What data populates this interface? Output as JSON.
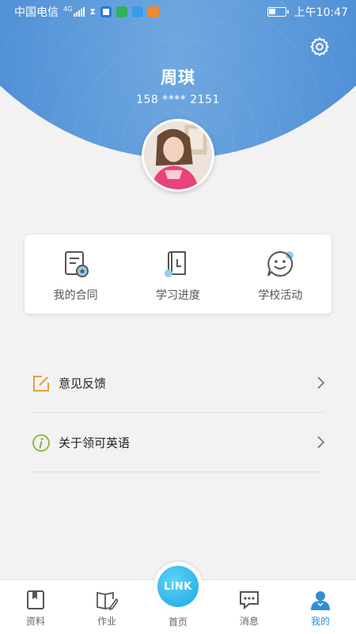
{
  "status_bar": {
    "carrier": "中国电信",
    "network": "4G",
    "time": "上午10:47"
  },
  "profile": {
    "name": "周琪",
    "phone": "158 **** 2151"
  },
  "quick_actions": [
    {
      "label": "我的合同",
      "icon": "contract-icon"
    },
    {
      "label": "学习进度",
      "icon": "progress-book-icon"
    },
    {
      "label": "学校活动",
      "icon": "smiley-chat-icon"
    }
  ],
  "menu": [
    {
      "label": "意见反馈",
      "icon": "feedback-edit-icon"
    },
    {
      "label": "关于领可英语",
      "icon": "info-icon"
    }
  ],
  "tabs": [
    {
      "label": "资料",
      "icon": "bookmark-book-icon"
    },
    {
      "label": "作业",
      "icon": "book-pencil-icon"
    },
    {
      "label": "首页",
      "badge": "LiNK"
    },
    {
      "label": "消息",
      "icon": "chat-bubble-icon"
    },
    {
      "label": "我的",
      "icon": "user-icon"
    }
  ],
  "colors": {
    "header_blue": "#4f8fd6",
    "accent_blue": "#2e8ed6",
    "link_cyan": "#1aa7e6",
    "feedback_orange": "#e3a23a",
    "info_green": "#8ab531"
  }
}
